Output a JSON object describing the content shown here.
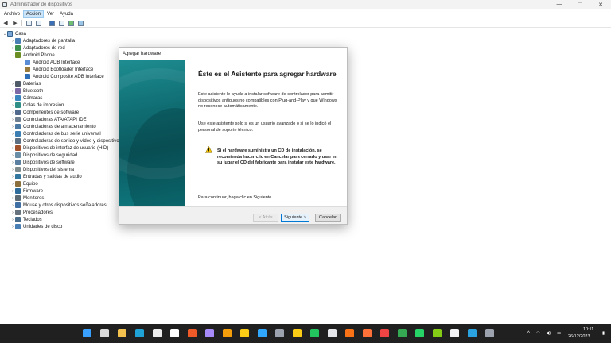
{
  "window": {
    "title": "Administrador de dispositivos",
    "minimize": "—",
    "maximize": "❐",
    "close": "✕"
  },
  "menu": [
    "Archivo",
    "Acción",
    "Ver",
    "Ayuda"
  ],
  "menu_active_index": 1,
  "tree": {
    "root": "Casa",
    "items": [
      {
        "label": "Adaptadores de pantalla",
        "level": 1,
        "expanded": false,
        "icon": "display-adapter-icon"
      },
      {
        "label": "Adaptadores de red",
        "level": 1,
        "expanded": false,
        "icon": "network-icon"
      },
      {
        "label": "Android Phone",
        "level": 1,
        "expanded": true,
        "icon": "phone-icon"
      },
      {
        "label": "Android ADB Interface",
        "level": 2,
        "icon": "device-icon"
      },
      {
        "label": "Android Bootloader Interface",
        "level": 2,
        "icon": "device-icon"
      },
      {
        "label": "Android Composite ADB Interface",
        "level": 2,
        "icon": "device-icon"
      },
      {
        "label": "Baterías",
        "level": 1,
        "expanded": false,
        "icon": "battery-icon"
      },
      {
        "label": "Bluetooth",
        "level": 1,
        "expanded": false,
        "icon": "bluetooth-icon"
      },
      {
        "label": "Cámaras",
        "level": 1,
        "expanded": false,
        "icon": "camera-icon"
      },
      {
        "label": "Colas de impresión",
        "level": 1,
        "expanded": false,
        "icon": "printer-icon"
      },
      {
        "label": "Componentes de software",
        "level": 1,
        "expanded": false,
        "icon": "software-icon"
      },
      {
        "label": "Controladoras ATA/ATAPI IDE",
        "level": 1,
        "expanded": false,
        "icon": "controller-icon"
      },
      {
        "label": "Controladoras de almacenamiento",
        "level": 1,
        "expanded": false,
        "icon": "storage-icon"
      },
      {
        "label": "Controladoras de bus serie universal",
        "level": 1,
        "expanded": false,
        "icon": "usb-icon"
      },
      {
        "label": "Controladoras de sonido y vídeo y dispositivos de juego",
        "level": 1,
        "expanded": false,
        "icon": "sound-icon"
      },
      {
        "label": "Dispositivos de interfaz de usuario (HID)",
        "level": 1,
        "expanded": false,
        "icon": "hid-icon"
      },
      {
        "label": "Dispositivos de seguridad",
        "level": 1,
        "expanded": false,
        "icon": "security-icon"
      },
      {
        "label": "Dispositivos de software",
        "level": 1,
        "expanded": false,
        "icon": "software-device-icon"
      },
      {
        "label": "Dispositivos del sistema",
        "level": 1,
        "expanded": false,
        "icon": "system-icon"
      },
      {
        "label": "Entradas y salidas de audio",
        "level": 1,
        "expanded": false,
        "icon": "audio-icon"
      },
      {
        "label": "Equipo",
        "level": 1,
        "expanded": false,
        "icon": "computer-icon"
      },
      {
        "label": "Firmware",
        "level": 1,
        "expanded": false,
        "icon": "firmware-icon"
      },
      {
        "label": "Monitores",
        "level": 1,
        "expanded": false,
        "icon": "monitor-icon"
      },
      {
        "label": "Mouse y otros dispositivos señaladores",
        "level": 1,
        "expanded": false,
        "icon": "mouse-icon"
      },
      {
        "label": "Procesadores",
        "level": 1,
        "expanded": false,
        "icon": "processor-icon"
      },
      {
        "label": "Teclados",
        "level": 1,
        "expanded": false,
        "icon": "keyboard-icon"
      },
      {
        "label": "Unidades de disco",
        "level": 1,
        "expanded": false,
        "icon": "disk-icon"
      }
    ]
  },
  "dialog": {
    "title": "Agregar hardware",
    "heading": "Éste es el Asistente para agregar hardware",
    "p1": "Este asistente le ayuda a instalar software de controlador para admitir dispositivos antiguos no compatibles con Plug-and-Play y que Windows no reconoce automáticamente.",
    "p2": "Use este asistente solo si es un usuario avanzado o si se lo indicó el personal de soporte técnico.",
    "warning": "Si el hardware suministra un CD de instalación, se recomienda hacer clic en Cancelar para cerrarlo y usar en su lugar el CD del fabricante para instalar este hardware.",
    "continue": "Para continuar, haga clic en Siguiente.",
    "back_label": "< Atrás",
    "next_label": "Siguiente >",
    "cancel_label": "Cancelar"
  },
  "taskbar": {
    "apps": [
      {
        "name": "start-icon",
        "color": "#3aa0ff"
      },
      {
        "name": "search-icon",
        "color": "#d9d9d9"
      },
      {
        "name": "file-explorer-icon",
        "color": "#f2c14e"
      },
      {
        "name": "edge-icon",
        "color": "#1fa3d6"
      },
      {
        "name": "notepad-icon",
        "color": "#ececec"
      },
      {
        "name": "app-l-icon",
        "color": "#ffffff"
      },
      {
        "name": "brave-icon",
        "color": "#f05a28"
      },
      {
        "name": "vpn-icon",
        "color": "#a78bfa"
      },
      {
        "name": "key-icon",
        "color": "#f59e0b"
      },
      {
        "name": "sticky-notes-icon",
        "color": "#facc15"
      },
      {
        "name": "photoshop-icon",
        "color": "#31a8ff"
      },
      {
        "name": "pointer-app-icon",
        "color": "#9ca3af"
      },
      {
        "name": "warning-app-icon",
        "color": "#facc15"
      },
      {
        "name": "xbox-icon",
        "color": "#22c55e"
      },
      {
        "name": "steam-icon",
        "color": "#e5e7eb"
      },
      {
        "name": "vlc-icon",
        "color": "#f97316"
      },
      {
        "name": "firefox-icon",
        "color": "#ff7139"
      },
      {
        "name": "opera-icon",
        "color": "#ef4444"
      },
      {
        "name": "chrome-icon",
        "color": "#34a853"
      },
      {
        "name": "whatsapp-icon",
        "color": "#25d366"
      },
      {
        "name": "folder-app-icon",
        "color": "#84cc16"
      },
      {
        "name": "capcut-icon",
        "color": "#f3f4f6"
      },
      {
        "name": "telegram-icon",
        "color": "#2aa3e0"
      },
      {
        "name": "device-manager-task-icon",
        "color": "#9ca3af"
      }
    ],
    "tray_arrow": "^",
    "time": "10:11",
    "date": "26/12/2023"
  },
  "colors": {
    "accent": "#0078d4",
    "dialog_side": "#0f6d72",
    "taskbar": "#202020"
  }
}
